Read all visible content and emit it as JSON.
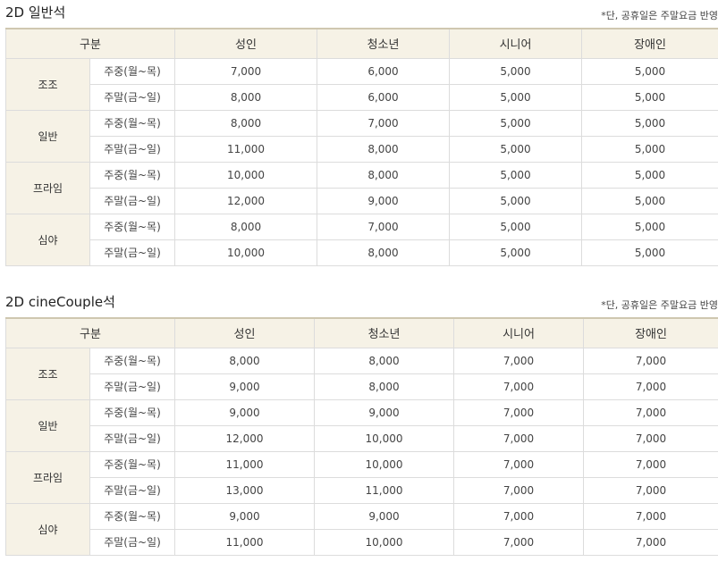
{
  "sections": [
    {
      "title": "2D 일반석",
      "note": "*단, 공휴일은 주말요금 반영",
      "headers": [
        "구분",
        "성인",
        "청소년",
        "시니어",
        "장애인"
      ],
      "groups": [
        {
          "label": "조조",
          "rows": [
            {
              "day": "주중(월~목)",
              "prices": [
                "7,000",
                "6,000",
                "5,000",
                "5,000"
              ]
            },
            {
              "day": "주말(금~일)",
              "prices": [
                "8,000",
                "6,000",
                "5,000",
                "5,000"
              ]
            }
          ]
        },
        {
          "label": "일반",
          "rows": [
            {
              "day": "주중(월~목)",
              "prices": [
                "8,000",
                "7,000",
                "5,000",
                "5,000"
              ]
            },
            {
              "day": "주말(금~일)",
              "prices": [
                "11,000",
                "8,000",
                "5,000",
                "5,000"
              ]
            }
          ]
        },
        {
          "label": "프라임",
          "rows": [
            {
              "day": "주중(월~목)",
              "prices": [
                "10,000",
                "8,000",
                "5,000",
                "5,000"
              ]
            },
            {
              "day": "주말(금~일)",
              "prices": [
                "12,000",
                "9,000",
                "5,000",
                "5,000"
              ]
            }
          ]
        },
        {
          "label": "심야",
          "rows": [
            {
              "day": "주중(월~목)",
              "prices": [
                "8,000",
                "7,000",
                "5,000",
                "5,000"
              ]
            },
            {
              "day": "주말(금~일)",
              "prices": [
                "10,000",
                "8,000",
                "5,000",
                "5,000"
              ]
            }
          ]
        }
      ]
    },
    {
      "title": "2D cineCouple석",
      "note": "*단, 공휴일은 주말요금 반영",
      "headers": [
        "구분",
        "성인",
        "청소년",
        "시니어",
        "장애인"
      ],
      "groups": [
        {
          "label": "조조",
          "rows": [
            {
              "day": "주중(월~목)",
              "prices": [
                "8,000",
                "8,000",
                "7,000",
                "7,000"
              ]
            },
            {
              "day": "주말(금~일)",
              "prices": [
                "9,000",
                "8,000",
                "7,000",
                "7,000"
              ]
            }
          ]
        },
        {
          "label": "일반",
          "rows": [
            {
              "day": "주중(월~목)",
              "prices": [
                "9,000",
                "9,000",
                "7,000",
                "7,000"
              ]
            },
            {
              "day": "주말(금~일)",
              "prices": [
                "12,000",
                "10,000",
                "7,000",
                "7,000"
              ]
            }
          ]
        },
        {
          "label": "프라임",
          "rows": [
            {
              "day": "주중(월~목)",
              "prices": [
                "11,000",
                "10,000",
                "7,000",
                "7,000"
              ]
            },
            {
              "day": "주말(금~일)",
              "prices": [
                "13,000",
                "11,000",
                "7,000",
                "7,000"
              ]
            }
          ]
        },
        {
          "label": "심야",
          "rows": [
            {
              "day": "주중(월~목)",
              "prices": [
                "9,000",
                "9,000",
                "7,000",
                "7,000"
              ]
            },
            {
              "day": "주말(금~일)",
              "prices": [
                "11,000",
                "10,000",
                "7,000",
                "7,000"
              ]
            }
          ]
        }
      ]
    }
  ]
}
